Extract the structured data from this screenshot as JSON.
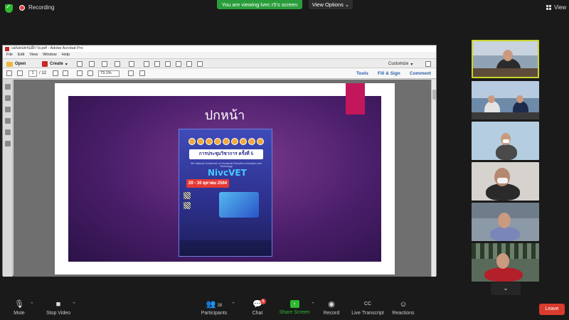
{
  "topbar": {
    "recording_label": "Recording",
    "viewing_banner": "You are viewing lvec r5's screen",
    "view_options_label": "View Options",
    "view_label": "View"
  },
  "acrobat": {
    "title": "แผ่นพบพรมอีกาย.pdf - Adobe Acrobat Pro",
    "menu": [
      "File",
      "Edit",
      "View",
      "Window",
      "Help"
    ],
    "open_label": "Open",
    "create_label": "Create",
    "customize_label": "Customize",
    "page_current": "1",
    "page_total": "/ 12",
    "zoom_value": "73.1%",
    "tools_label": "Tools",
    "fill_sign_label": "Fill & Sign",
    "comment_label": "Comment"
  },
  "slide": {
    "title": "ปกหน้า",
    "poster_banner": "การประชุมวิชาการ ครั้งที่ 5",
    "poster_subtitle": "5th National Conference of Vocational Education Innovation and Technology",
    "poster_logo": "NivcVET",
    "poster_date": "29 - 30 ตุลาคม 2564"
  },
  "toolbar": {
    "mute_label": "Mute",
    "stop_video_label": "Stop Video",
    "participants_label": "Participants",
    "participants_count": "38",
    "chat_label": "Chat",
    "chat_badge": "8",
    "share_screen_label": "Share Screen",
    "record_label": "Record",
    "live_transcript_label": "Live Transcript",
    "reactions_label": "Reactions",
    "leave_label": "Leave"
  },
  "colors": {
    "active_speaker": "#c9d62b",
    "share_green": "#2eb82e",
    "leave_red": "#d93c2f",
    "slide_purple": "#4a1e6a",
    "slide_tab": "#c2185b"
  }
}
